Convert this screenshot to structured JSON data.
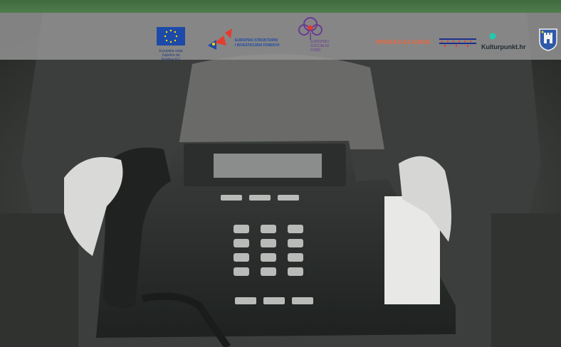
{
  "header": {
    "bar_color": "#4a7547"
  },
  "logos": {
    "eu_caption": "Europska unija",
    "eu_sub": "Zajedno do fondova EU",
    "esif_line1": "EUROPSKI STRUKTURNI",
    "esif_line2": "I INVESTICIJSKI FONDOVI",
    "esf_line1": "EUROPSKI",
    "esf_line2": "SOCIJALNI",
    "esf_line3": "FOND",
    "operacija": "OPERACIJA GRAD",
    "kulturpunkt": "Kulturpunkt.hr"
  },
  "hero": {
    "image": "grayscale-photo-person-holding-desk-telephone"
  },
  "colors": {
    "accent_green": "#4a7547",
    "strip_gray": "#959595",
    "eu_blue": "#1d4aa8",
    "eu_star": "#ffdd00",
    "esif_red": "#e43c2e",
    "esf_purple": "#6a3b92",
    "operacija_orange": "#f0653a",
    "kultur_teal": "#23c9b0"
  }
}
